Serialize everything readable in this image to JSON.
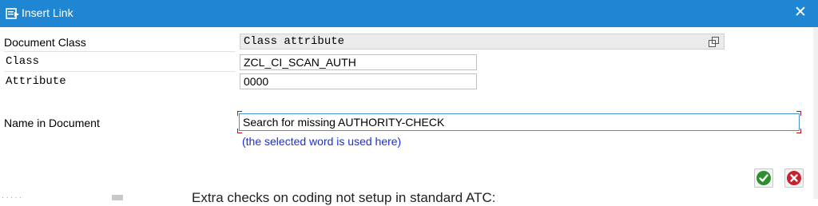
{
  "window": {
    "title": "Insert Link",
    "accent": "#1f86d4"
  },
  "form": {
    "document_class": {
      "label": "Document Class",
      "value": "Class attribute"
    },
    "class": {
      "label": "Class",
      "value": "ZCL_CI_SCAN_AUTH"
    },
    "attribute": {
      "label": "Attribute",
      "value": "0000"
    },
    "name_in_document": {
      "label": "Name in Document",
      "value": "Search for missing AUTHORITY-CHECK"
    },
    "hint": "(the selected word is used here)"
  },
  "buttons": {
    "ok_icon": "checkmark-icon",
    "cancel_icon": "cancel-icon"
  },
  "background": {
    "partial_text": "Extra checks on coding not setup in standard ATC:"
  }
}
